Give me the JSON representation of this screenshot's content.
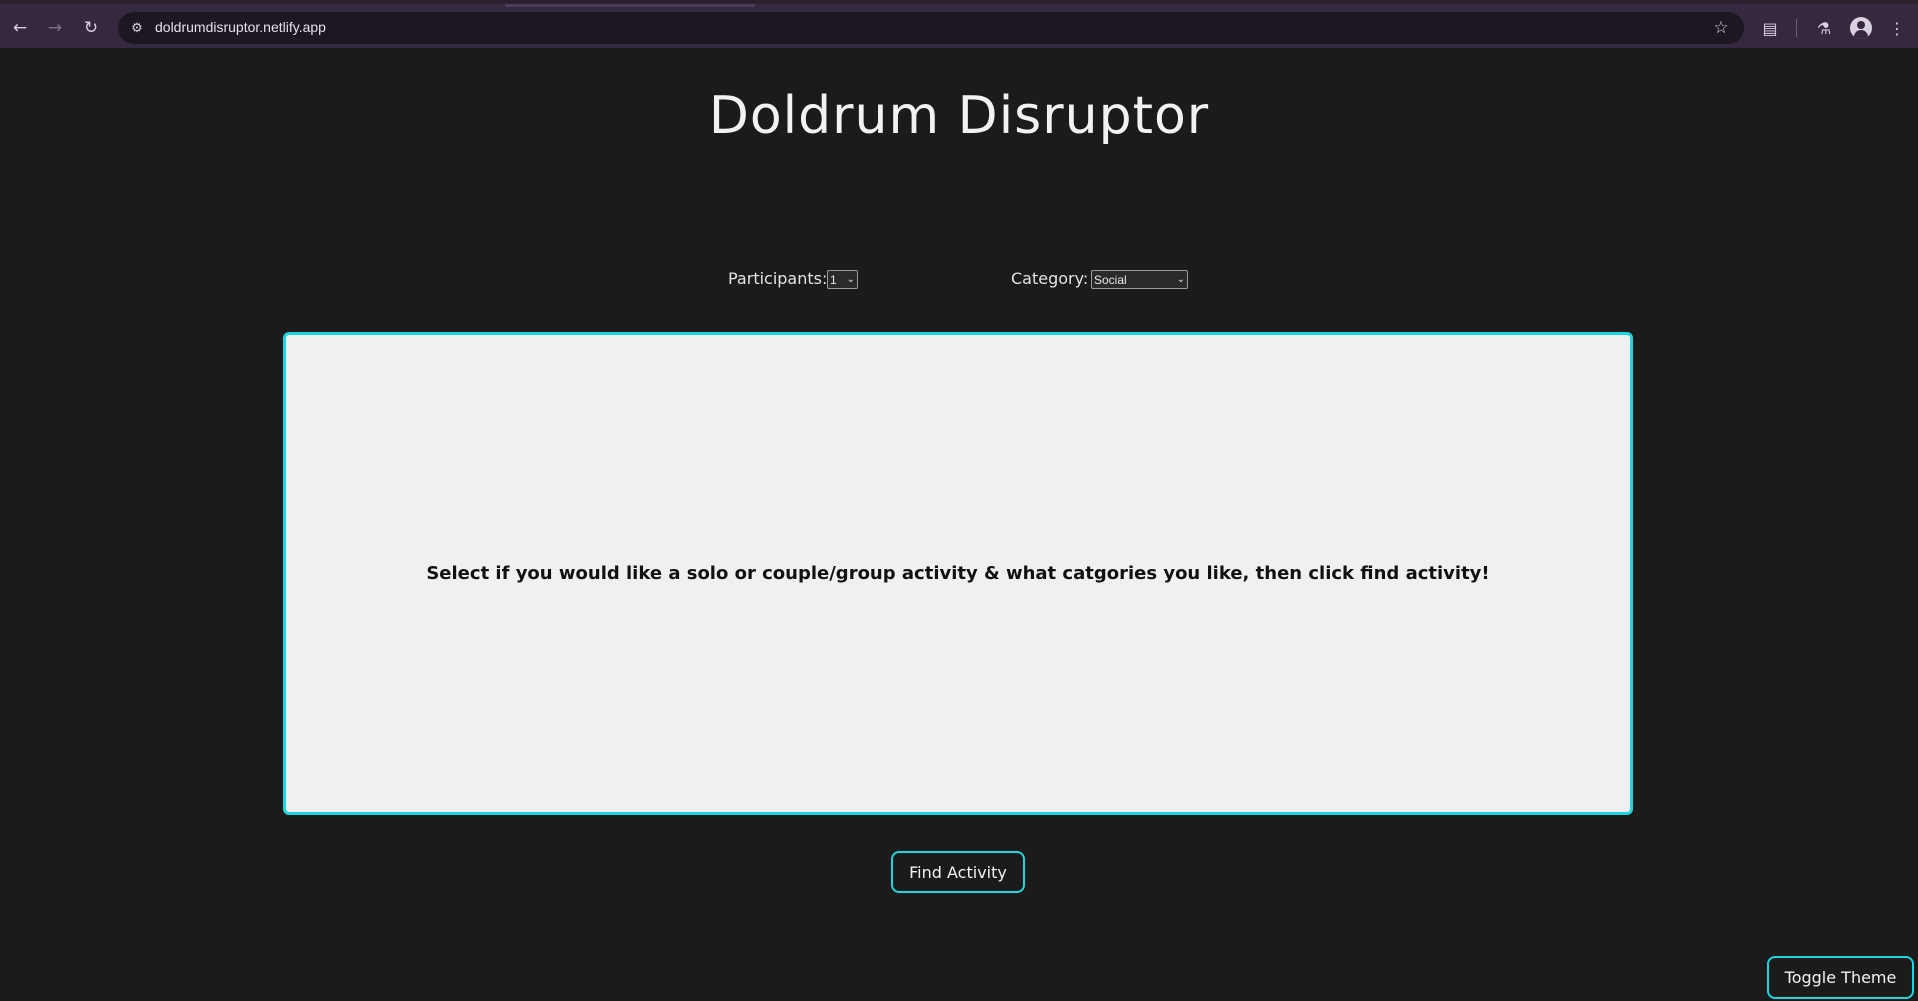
{
  "browser": {
    "url": "doldrumdisruptor.netlify.app",
    "icons": {
      "back": "back-arrow-icon",
      "forward": "forward-arrow-icon",
      "reload": "reload-icon",
      "site_info": "site-info-icon",
      "bookmark": "star-icon",
      "extensions": "puzzle-icon",
      "labs": "flask-icon",
      "profile": "avatar-icon",
      "menu": "kebab-menu-icon"
    }
  },
  "page": {
    "title": "Doldrum Disruptor",
    "filters": {
      "participants_label": "Participants:",
      "participants_value": "1",
      "category_label": "Category:",
      "category_value": "Social"
    },
    "activity_message": "Select if you would like a solo or couple/group activity & what catgories you like, then click find activity!",
    "find_button_label": "Find Activity",
    "toggle_theme_label": "Toggle Theme"
  },
  "colors": {
    "background": "#1b1b1b",
    "accent": "#1ed6e0",
    "card": "#f0f0f0",
    "browser_chrome": "#35293f"
  }
}
